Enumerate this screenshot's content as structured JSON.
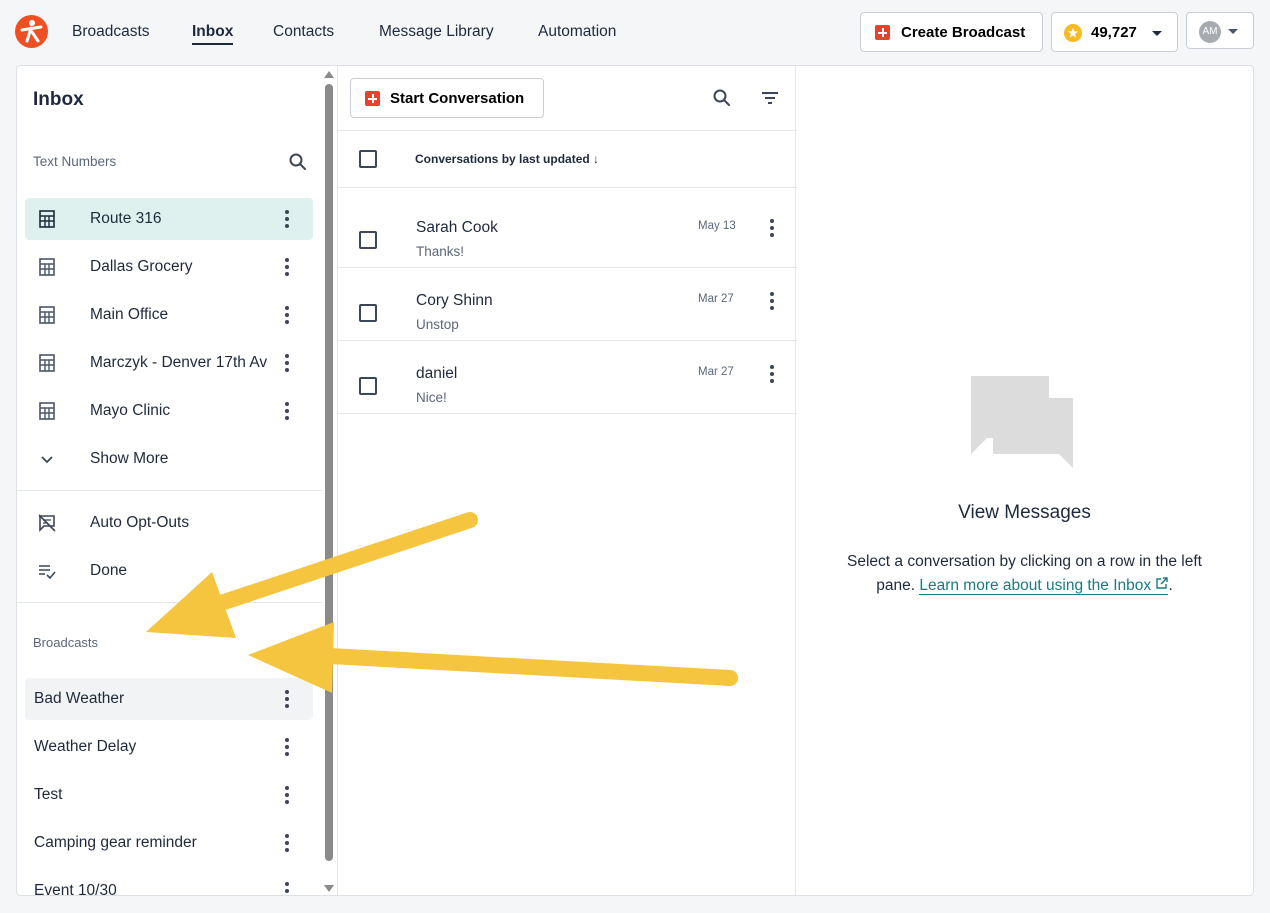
{
  "nav": {
    "items": [
      "Broadcasts",
      "Inbox",
      "Contacts",
      "Message Library",
      "Automation"
    ],
    "active": "Inbox"
  },
  "header": {
    "create_broadcast": "Create Broadcast",
    "credits": "49,727",
    "avatar_initials": "AM"
  },
  "sidebar": {
    "title": "Inbox",
    "text_numbers_label": "Text Numbers",
    "numbers": [
      "Route 316",
      "Dallas Grocery",
      "Main Office",
      "Marczyk - Denver 17th Av",
      "Mayo Clinic"
    ],
    "show_more": "Show More",
    "filters": [
      "Auto Opt-Outs",
      "Done"
    ],
    "broadcasts_label": "Broadcasts",
    "broadcasts": [
      "Bad Weather",
      "Weather Delay",
      "Test",
      "Camping gear reminder",
      "Event 10/30"
    ]
  },
  "conversations": {
    "start_button": "Start Conversation",
    "sort_label": "Conversations by last updated",
    "items": [
      {
        "name": "Sarah Cook",
        "preview": "Thanks!",
        "date": "May 13"
      },
      {
        "name": "Cory Shinn",
        "preview": "Unstop",
        "date": "Mar 27"
      },
      {
        "name": "daniel",
        "preview": "Nice!",
        "date": "Mar 27"
      }
    ]
  },
  "viewer": {
    "title": "View Messages",
    "desc": "Select a conversation by clicking on a row in the left pane.",
    "link": "Learn more about using the Inbox",
    "after_link": "."
  },
  "colors": {
    "brand": "#f04e23",
    "accent": "#177c82",
    "selected_bg": "#dff1ef",
    "annotation_arrow": "#f6c53f"
  }
}
